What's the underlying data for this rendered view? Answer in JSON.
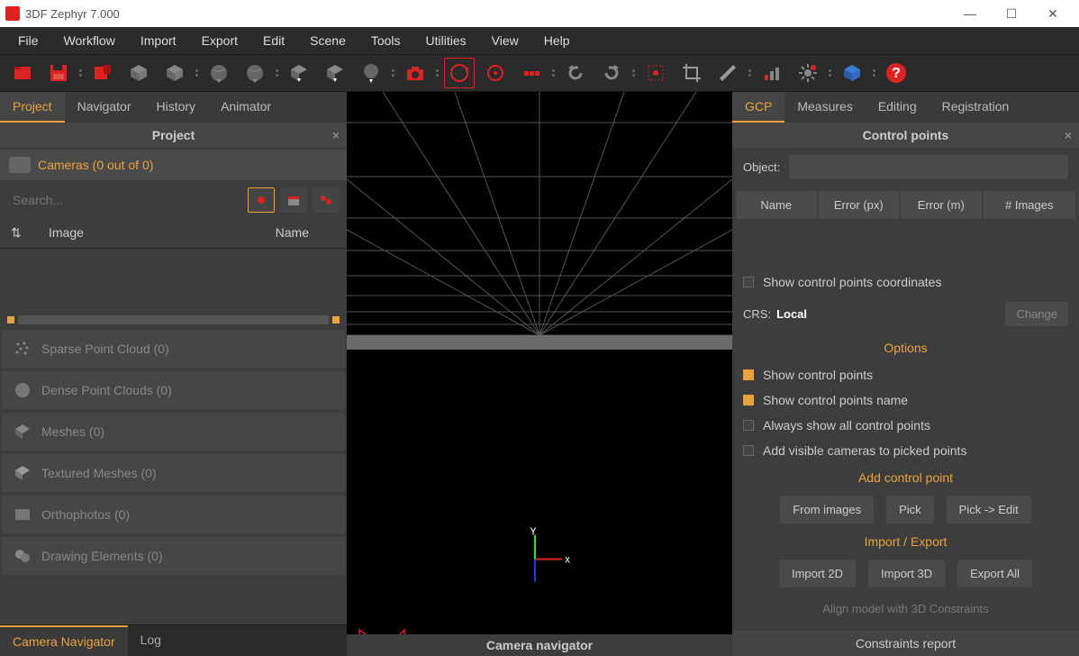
{
  "title": "3DF Zephyr 7.000",
  "menus": [
    "File",
    "Workflow",
    "Import",
    "Export",
    "Edit",
    "Scene",
    "Tools",
    "Utilities",
    "View",
    "Help"
  ],
  "leftTabs": [
    "Project",
    "Navigator",
    "History",
    "Animator"
  ],
  "leftActiveTab": "Project",
  "panelTitle": "Project",
  "camerasLabel": "Cameras (0 out of 0)",
  "searchPlaceholder": "Search...",
  "listCols": {
    "image": "Image",
    "name": "Name"
  },
  "tree": [
    "Sparse Point Cloud (0)",
    "Dense Point Clouds (0)",
    "Meshes (0)",
    "Textured Meshes (0)",
    "Orthophotos (0)",
    "Drawing Elements (0)"
  ],
  "bottomTabs": [
    "Camera Navigator",
    "Log"
  ],
  "bottomActiveTab": "Camera Navigator",
  "viewportFooter": "Camera navigator",
  "rightTabs": [
    "GCP",
    "Measures",
    "Editing",
    "Registration"
  ],
  "rightActiveTab": "GCP",
  "rightPanelTitle": "Control points",
  "objectLabel": "Object:",
  "gcpCols": [
    "Name",
    "Error (px)",
    "Error (m)",
    "# Images"
  ],
  "showCoords": "Show control points coordinates",
  "crsLabel": "CRS:",
  "crsValue": "Local",
  "changeBtn": "Change",
  "optionsTitle": "Options",
  "options": [
    {
      "label": "Show control points",
      "checked": true
    },
    {
      "label": "Show control points name",
      "checked": true
    },
    {
      "label": "Always show all control points",
      "checked": false
    },
    {
      "label": "Add visible cameras to picked points",
      "checked": false
    }
  ],
  "addCPTitle": "Add control point",
  "addCPButtons": [
    "From images",
    "Pick",
    "Pick -> Edit"
  ],
  "ioTitle": "Import / Export",
  "ioButtons": [
    "Import 2D",
    "Import 3D",
    "Export All"
  ],
  "alignText": "Align model with 3D Constraints",
  "constraintsFooter": "Constraints report",
  "axis": {
    "x": "x",
    "y": "Y"
  }
}
